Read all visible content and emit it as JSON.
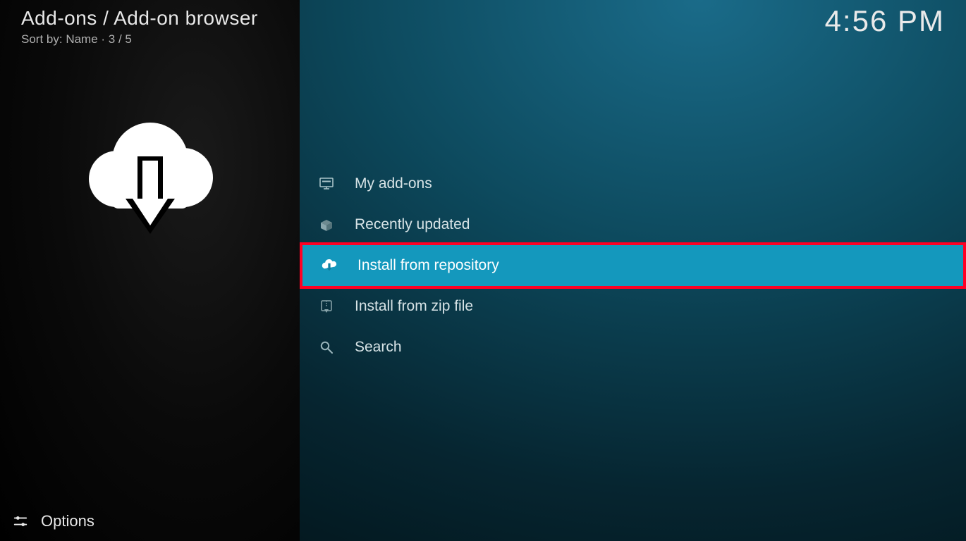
{
  "header": {
    "breadcrumb": "Add-ons / Add-on browser",
    "sort_prefix": "Sort by: ",
    "sort_value": "Name",
    "separator": "  ·  ",
    "position": "3 / 5"
  },
  "clock": "4:56 PM",
  "sidebar": {
    "options_label": "Options"
  },
  "menu": {
    "items": [
      {
        "key": "my-addons",
        "label": "My add-ons",
        "icon": "monitor-icon",
        "selected": false
      },
      {
        "key": "recently-updated",
        "label": "Recently updated",
        "icon": "box-open-icon",
        "selected": false
      },
      {
        "key": "install-repo",
        "label": "Install from repository",
        "icon": "cloud-download-icon",
        "selected": true
      },
      {
        "key": "install-zip",
        "label": "Install from zip file",
        "icon": "zip-download-icon",
        "selected": false
      },
      {
        "key": "search",
        "label": "Search",
        "icon": "search-icon",
        "selected": false
      }
    ]
  },
  "highlight_color": "#ff0024",
  "accent_color": "#1498bd"
}
